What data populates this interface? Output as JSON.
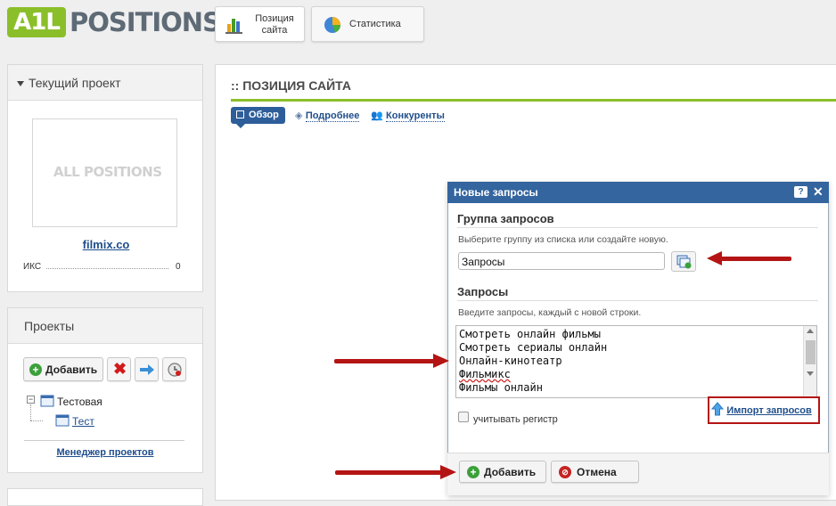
{
  "logo": {
    "badge": "A1L",
    "text": "POSITIONS"
  },
  "top_nav": [
    {
      "label": "Позиция сайта"
    },
    {
      "label": "Статистика"
    }
  ],
  "current_project": {
    "header": "Текущий проект",
    "thumbnail_text": "ALL POSITIONS",
    "site": "filmix.co",
    "metric_label": "ИКС",
    "metric_value": "0"
  },
  "projects": {
    "header": "Проекты",
    "add_label": "Добавить",
    "tree_group": "Тестовая",
    "tree_item": "Тест",
    "manager_link": "Менеджер проектов"
  },
  "main": {
    "title": ":: ПОЗИЦИЯ САЙТА",
    "tabs": [
      {
        "label": "Обзор"
      },
      {
        "label": "Подробнее"
      },
      {
        "label": "Конкуренты"
      }
    ]
  },
  "dialog": {
    "title": "Новые запросы",
    "group_header": "Группа запросов",
    "group_hint": "Выберите группу из списка или создайте новую.",
    "group_value": "Запросы",
    "queries_header": "Запросы",
    "queries_hint": "Введите запросы, каждый с новой строки.",
    "queries": [
      "Смотреть онлайн фильмы",
      "Смотреть сериалы онлайн",
      "Онлайн-кинотеатр",
      "Фильмикс",
      "Фильмы онлайн"
    ],
    "case_label": "учитывать регистр",
    "import_label": "Импорт запросов",
    "add_label": "Добавить",
    "cancel_label": "Отмена"
  },
  "colors": {
    "accent_green": "#8bbf2a",
    "dialog_blue": "#34659e",
    "arrow_red": "#b41414"
  }
}
